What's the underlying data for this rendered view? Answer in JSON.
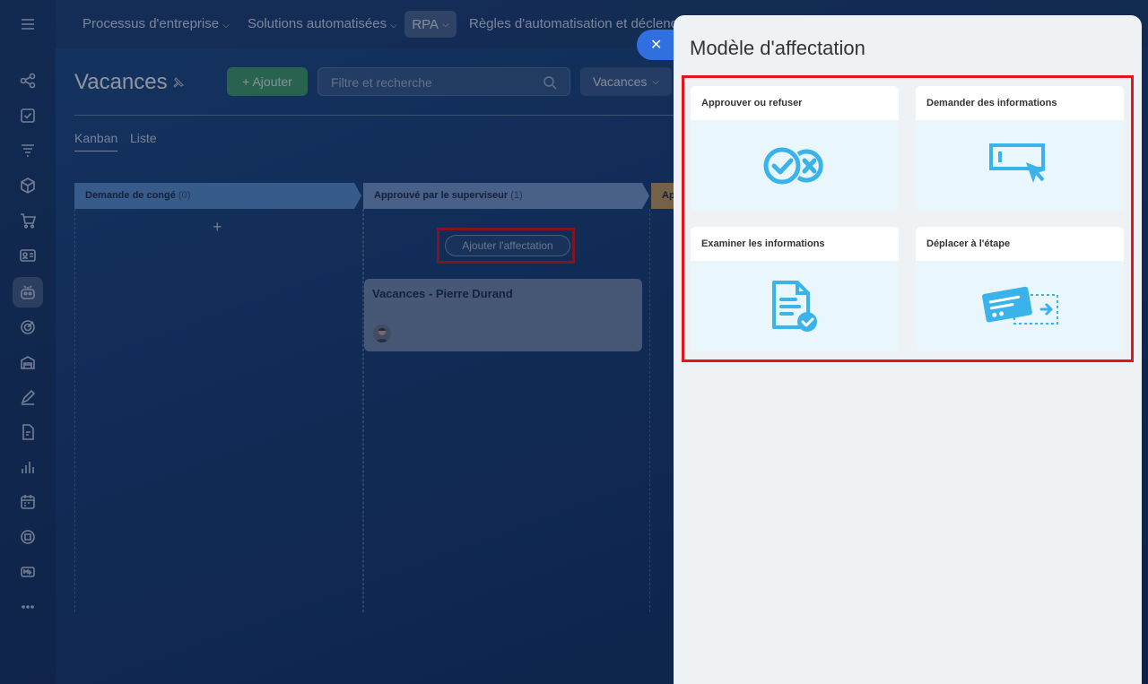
{
  "topnav": {
    "items": [
      {
        "label": "Processus d'entreprise"
      },
      {
        "label": "Solutions automatisées"
      },
      {
        "label": "RPA"
      },
      {
        "label": "Règles d'automatisation et déclenc"
      }
    ]
  },
  "rail_icons": [
    "menu-icon",
    "process-icon",
    "tasks-icon",
    "filter-icon",
    "box-icon",
    "cart-icon",
    "contacts-icon",
    "robot-icon",
    "target-icon",
    "warehouse-icon",
    "sign-icon",
    "document-icon",
    "analytics-icon",
    "calendar-icon",
    "store-icon",
    "marketing-icon",
    "more-icon"
  ],
  "page": {
    "title": "Vacances",
    "add_label": "+ Ajouter",
    "search_placeholder": "Filtre et recherche",
    "filter_label": "Vacances",
    "view_tabs": [
      "Kanban",
      "Liste"
    ]
  },
  "kanban": {
    "columns": [
      {
        "title": "Demande de congé",
        "count": "(0)",
        "color": "#5b95d8"
      },
      {
        "title": "Approuvé par le superviseur",
        "count": "(1)",
        "color": "#7c9fd4"
      },
      {
        "title": "Ap",
        "count": "",
        "color": "#c9a25e"
      }
    ],
    "add_assignment_label": "Ajouter l'affectation",
    "card": {
      "title": "Vacances - Pierre Durand"
    }
  },
  "panel": {
    "close_symbol": "✕",
    "title": "Modèle d'affectation",
    "tiles": [
      {
        "label": "Approuver ou refuser",
        "icon": "approve-reject-icon"
      },
      {
        "label": "Demander des informations",
        "icon": "request-info-icon"
      },
      {
        "label": "Examiner les informations",
        "icon": "review-document-icon"
      },
      {
        "label": "Déplacer à l'étape",
        "icon": "move-stage-icon"
      }
    ],
    "icon_color": "#3ab3ea",
    "highlight_color": "#e3141b"
  }
}
